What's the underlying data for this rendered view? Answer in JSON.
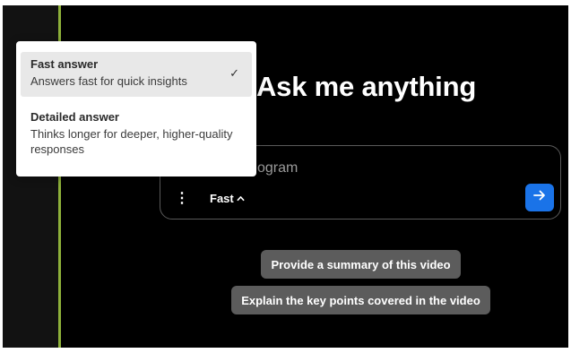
{
  "main": {
    "heading": "Ask me anything",
    "composer": {
      "placeholder_fragment": "ogram",
      "mode_label": "Fast",
      "more_icon_glyph": "⋮",
      "mode_chevron_glyph": "⌃",
      "send_icon": "arrow-right-icon"
    },
    "suggestions": [
      "Provide a summary of this video",
      "Explain the key points covered in the video"
    ]
  },
  "dropdown": {
    "options": [
      {
        "title": "Fast answer",
        "description": "Answers fast for quick insights",
        "selected": true
      },
      {
        "title": "Detailed answer",
        "description": "Thinks longer for deeper, higher-quality responses",
        "selected": false
      }
    ],
    "check_glyph": "✓"
  },
  "colors": {
    "background": "#000000",
    "accent_blue": "#1a73e8",
    "divider_green": "#8db03a",
    "chip_gray": "#5c5c5c",
    "selected_option_bg": "#e8e8e8"
  }
}
